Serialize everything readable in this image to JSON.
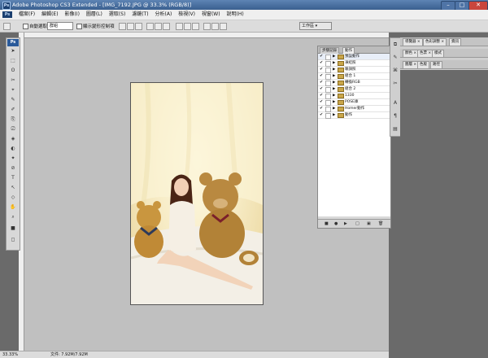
{
  "window": {
    "app_icon": "Ps",
    "title": "Adobe Photoshop CS3 Extended - [IMG_7192.JPG @ 33.3% (RGB/8)]",
    "minimize": "–",
    "maximize": "□",
    "close": "✕"
  },
  "menubar": {
    "logo": "Ps",
    "items": [
      "檔案(F)",
      "編輯(E)",
      "影像(I)",
      "圖層(L)",
      "選取(S)",
      "濾鏡(T)",
      "分析(A)",
      "檢視(V)",
      "視窗(W)",
      "說明(H)"
    ]
  },
  "options": {
    "auto_select": "自動選取:",
    "auto_select_value": "群組",
    "show_transform": "顯示變形控制項",
    "workspace": "工作區 ▾"
  },
  "tools": {
    "header": "Ps",
    "items": [
      "➤",
      "⬚",
      "ʘ",
      "✂",
      "⌖",
      "✎",
      "✐",
      "⎘",
      "⎚",
      "◈",
      "◐",
      "✦",
      "⊘",
      "T",
      "↖",
      "◇",
      "✋",
      "⌕",
      "■",
      "◻"
    ]
  },
  "layers_panel": {
    "tabs": [
      "步驟記錄",
      "動作"
    ],
    "rows": [
      {
        "name": "預設動作",
        "checked": true
      },
      {
        "name": "凍結照",
        "checked": true
      },
      {
        "name": "暖調照",
        "checked": true
      },
      {
        "name": "組合 1",
        "checked": true
      },
      {
        "name": "轉換RGB",
        "checked": true
      },
      {
        "name": "組合 2",
        "checked": true
      },
      {
        "name": "1330",
        "checked": true
      },
      {
        "name": "POSE庫",
        "checked": true
      },
      {
        "name": "Homer動作",
        "checked": true
      },
      {
        "name": "動作",
        "checked": true
      }
    ],
    "footer": [
      "■",
      "●",
      "▶",
      "□",
      "▣",
      "🗑"
    ]
  },
  "dock": {
    "icons": [
      "⧉",
      "✎",
      "⌘",
      "✂",
      "A",
      "¶",
      "▤"
    ],
    "panel1_tabs": [
      "導覽器 ×",
      "色彩調整 ×",
      "資訊"
    ],
    "panel2_tabs": [
      "顏色 ×",
      "色票 ×",
      "樣式"
    ],
    "panel3_tabs": [
      "圖層 ×",
      "色版",
      "路徑"
    ]
  },
  "status": {
    "zoom": "33.33%",
    "doc": "文件: 7.92M/7.92M"
  }
}
